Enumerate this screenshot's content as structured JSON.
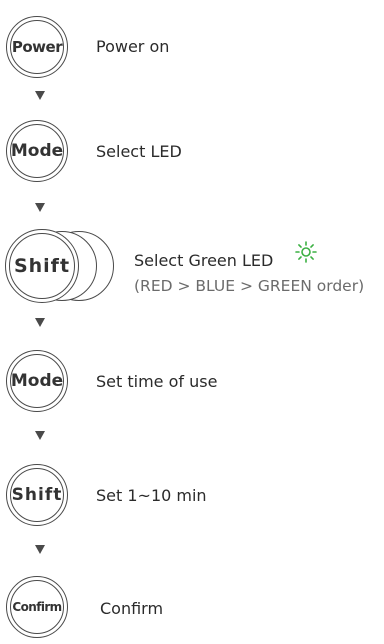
{
  "steps": [
    {
      "button": "Power",
      "text": "Power on"
    },
    {
      "button": "Mode",
      "text": "Select LED"
    },
    {
      "button": "Shift",
      "text": "Select Green LED",
      "note": "(RED > BLUE > GREEN order)"
    },
    {
      "button": "Mode",
      "text": "Set time of use"
    },
    {
      "button": "Shift",
      "text": "Set 1~10 min"
    },
    {
      "button": "Confirm",
      "text": "Confirm"
    }
  ],
  "colors": {
    "stroke": "#4a4a4a",
    "text": "#2b2b2b",
    "note": "#6b6b6b",
    "green_led": "#3cb043"
  },
  "icons": {
    "green_led": "sun-icon",
    "arrow": "down-triangle"
  }
}
